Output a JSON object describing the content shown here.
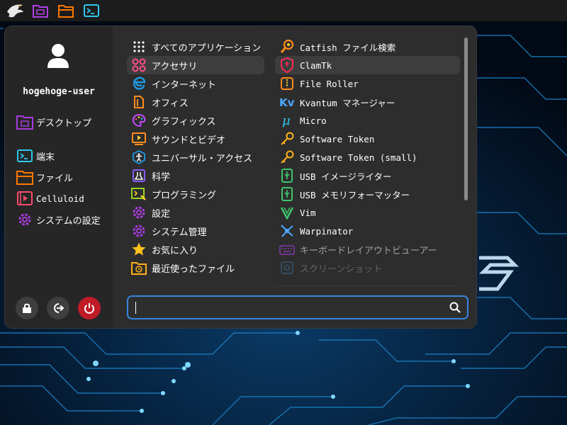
{
  "panel": {
    "icons": [
      "eagle-logo-icon",
      "desktop-folder-icon",
      "files-folder-icon",
      "terminal-icon"
    ]
  },
  "colors": {
    "accent": "#3584e4",
    "power": "#c01c28",
    "purple": "#a83bde",
    "orange": "#ff7800"
  },
  "sidebar": {
    "username": "hogehoge-user",
    "favorites": [
      {
        "label": "デスクトップ",
        "icon": "desktop-folder-icon"
      },
      {
        "label": "端末",
        "icon": "terminal-icon"
      },
      {
        "label": "ファイル",
        "icon": "folder-icon"
      },
      {
        "label": "Celluloid",
        "icon": "video-player-icon"
      },
      {
        "label": "システムの設定",
        "icon": "settings-gear-icon"
      }
    ],
    "buttons": [
      "lock-icon",
      "logout-icon",
      "power-icon"
    ]
  },
  "categories": [
    {
      "label": "すべてのアプリケーション",
      "icon": "grid-icon"
    },
    {
      "label": "アクセサリ",
      "icon": "accessories-icon",
      "selected": true
    },
    {
      "label": "インターネット",
      "icon": "internet-icon"
    },
    {
      "label": "オフィス",
      "icon": "office-icon"
    },
    {
      "label": "グラフィックス",
      "icon": "palette-icon"
    },
    {
      "label": "サウンドとビデオ",
      "icon": "multimedia-icon"
    },
    {
      "label": "ユニバーサル・アクセス",
      "icon": "accessibility-icon"
    },
    {
      "label": "科学",
      "icon": "science-icon"
    },
    {
      "label": "プログラミング",
      "icon": "programming-icon"
    },
    {
      "label": "設定",
      "icon": "settings-icon"
    },
    {
      "label": "システム管理",
      "icon": "system-admin-icon"
    },
    {
      "label": "お気に入り",
      "icon": "star-icon"
    },
    {
      "label": "最近使ったファイル",
      "icon": "recent-files-icon"
    }
  ],
  "apps": [
    {
      "label": "Catfish ファイル検索",
      "icon": "catfish-search-icon"
    },
    {
      "label": "ClamTk",
      "icon": "clamtk-shield-icon",
      "selected": true
    },
    {
      "label": "File Roller",
      "icon": "archive-icon"
    },
    {
      "label": "Kvantum マネージャー",
      "icon": "kvantum-icon"
    },
    {
      "label": "Micro",
      "icon": "micro-editor-icon"
    },
    {
      "label": "Software Token",
      "icon": "key-icon"
    },
    {
      "label": "Software Token (small)",
      "icon": "key-icon"
    },
    {
      "label": "USB イメージライター",
      "icon": "usb-icon"
    },
    {
      "label": "USB メモリフォーマッター",
      "icon": "usb-icon"
    },
    {
      "label": "Vim",
      "icon": "vim-icon"
    },
    {
      "label": "Warpinator",
      "icon": "warpinator-icon"
    },
    {
      "label": "キーボードレイアウトビューアー",
      "icon": "keyboard-icon"
    },
    {
      "label": "スクリーンショット",
      "icon": "screenshot-icon"
    }
  ],
  "search": {
    "value": "",
    "placeholder": ""
  }
}
